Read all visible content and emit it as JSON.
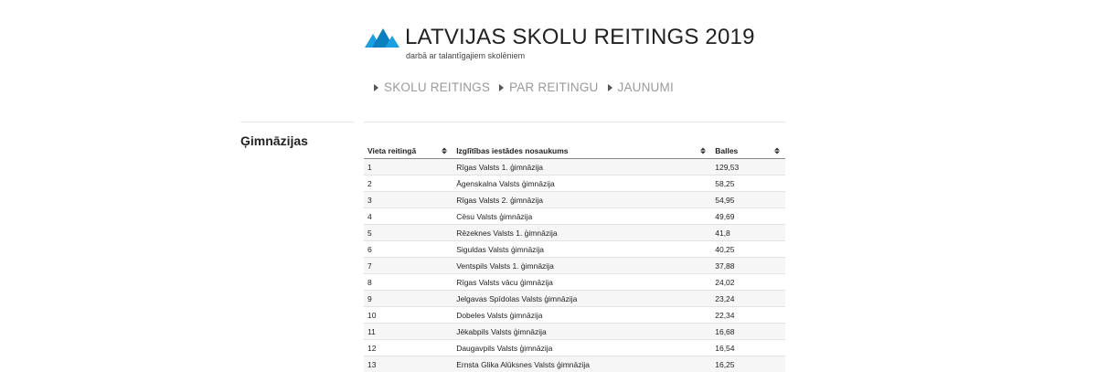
{
  "header": {
    "title": "LATVIJAS SKOLU REITINGS 2019",
    "subtitle": "darbā ar talantīgajiem skolēniem",
    "logo_icon": "mountains-icon",
    "logo_colors": [
      "#1aa0e0",
      "#0c7fbf"
    ]
  },
  "nav": {
    "items": [
      {
        "label": "SKOLU REITINGS"
      },
      {
        "label": "PAR REITINGU"
      },
      {
        "label": "JAUNUMI"
      }
    ]
  },
  "section": {
    "title": "Ģimnāzijas"
  },
  "table": {
    "columns": [
      "Vieta reitingā",
      "Izglītības iestādes nosaukums",
      "Balles"
    ],
    "rows": [
      [
        "1",
        "Rīgas Valsts 1. ģimnāzija",
        "129,53"
      ],
      [
        "2",
        "Āgenskalna Valsts ģimnāzija",
        "58,25"
      ],
      [
        "3",
        "Rīgas Valsts 2. ģimnāzija",
        "54,95"
      ],
      [
        "4",
        "Cēsu Valsts ģimnāzija",
        "49,69"
      ],
      [
        "5",
        "Rēzeknes Valsts 1. ģimnāzija",
        "41,8"
      ],
      [
        "6",
        "Siguldas Valsts ģimnāzija",
        "40,25"
      ],
      [
        "7",
        "Ventspils Valsts 1. ģimnāzija",
        "37,88"
      ],
      [
        "8",
        "Rīgas Valsts vācu ģimnāzija",
        "24,02"
      ],
      [
        "9",
        "Jelgavas Spīdolas Valsts ģimnāzija",
        "23,24"
      ],
      [
        "10",
        "Dobeles Valsts ģimnāzija",
        "22,34"
      ],
      [
        "11",
        "Jēkabpils Valsts ģimnāzija",
        "16,68"
      ],
      [
        "12",
        "Daugavpils Valsts ģimnāzija",
        "16,54"
      ],
      [
        "13",
        "Ernsta Glika Alūksnes Valsts ģimnāzija",
        "16,25"
      ]
    ]
  }
}
